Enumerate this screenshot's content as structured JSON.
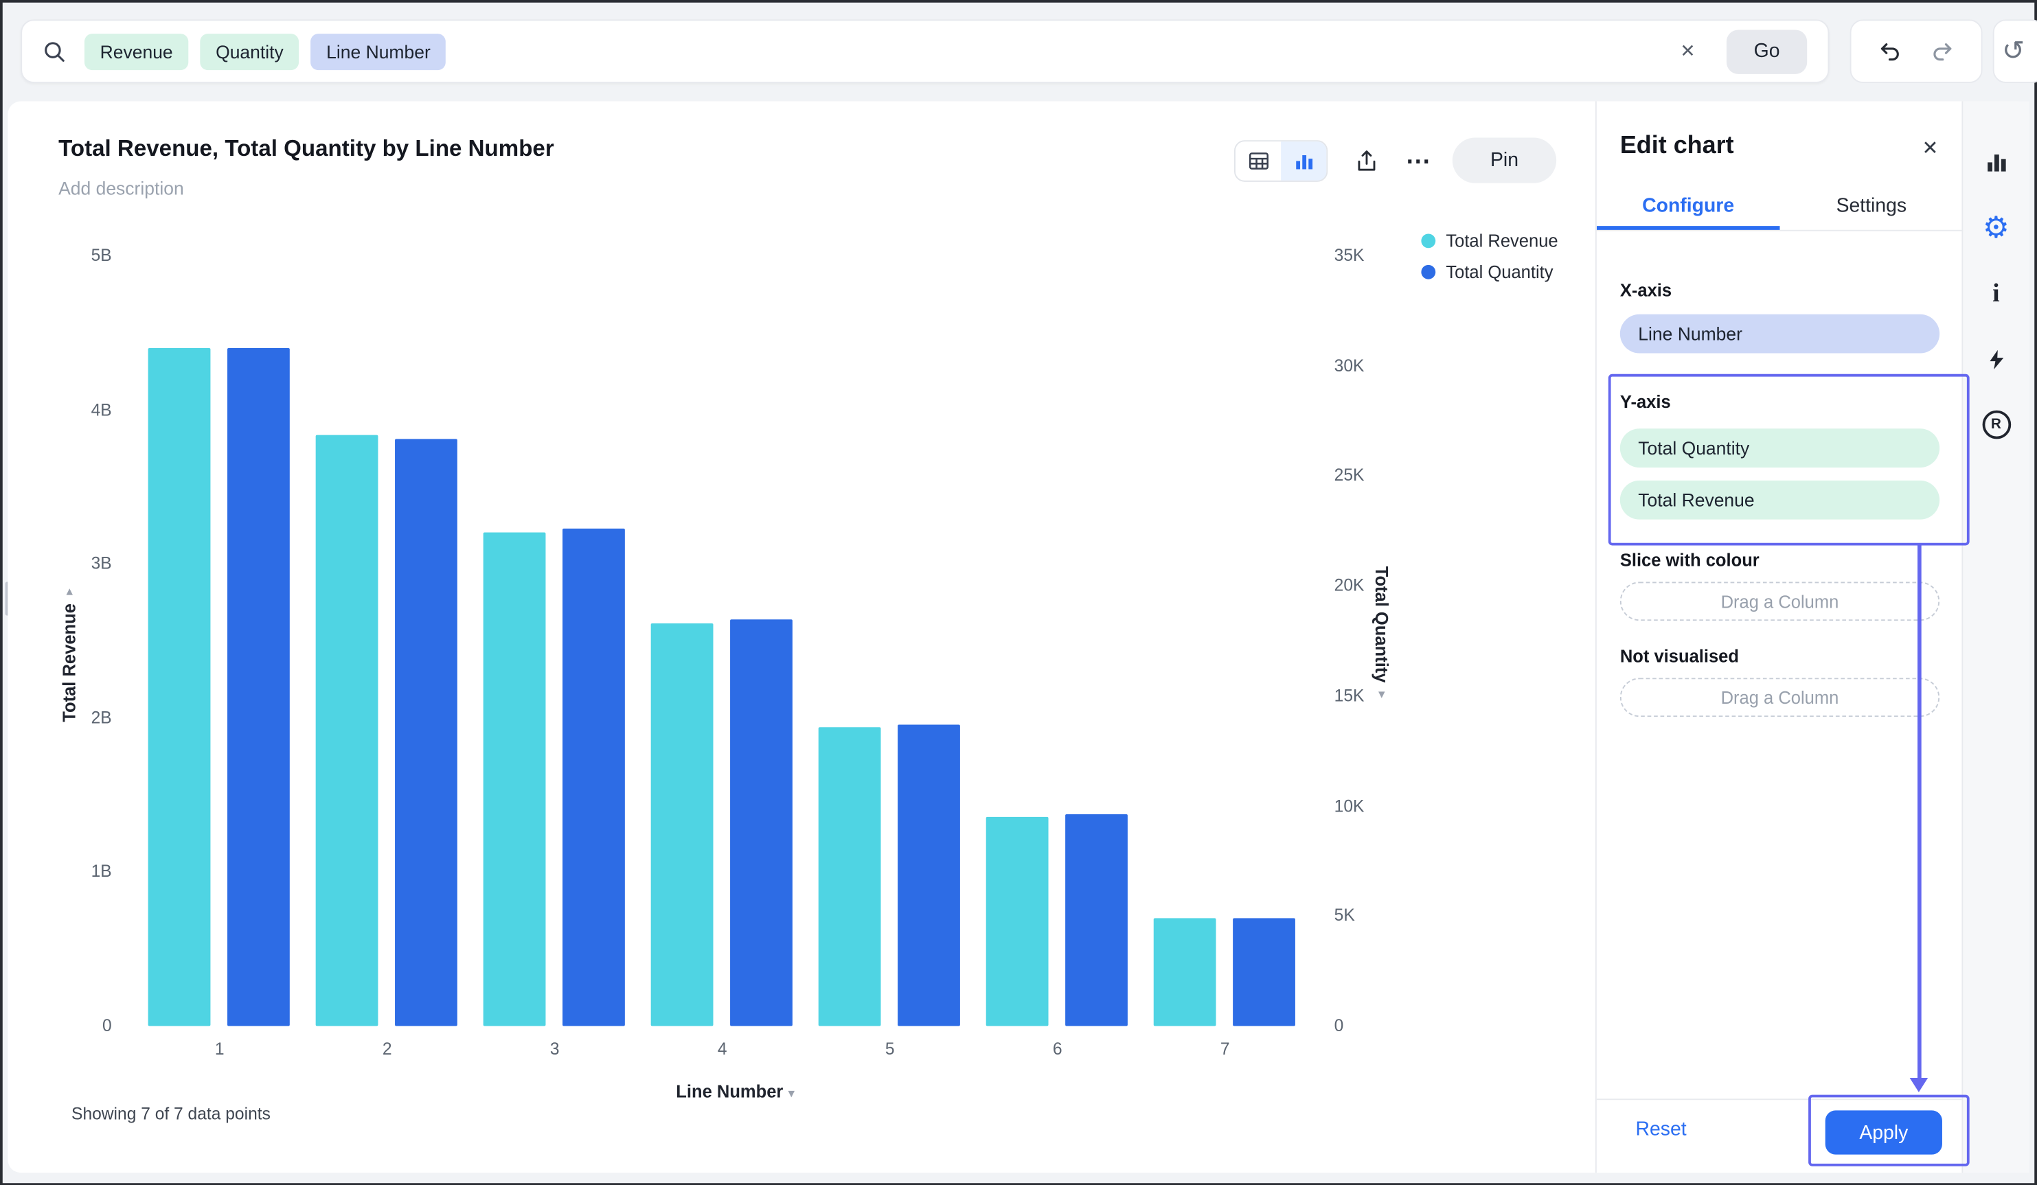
{
  "colors": {
    "accent_blue": "#2b6ef2",
    "annotation_purple": "#6467ef",
    "bar_cyan": "#4fd4e3",
    "bar_blue": "#2d6ce5",
    "token_green": "#d8f3e7",
    "token_lavender": "#cdd8f7"
  },
  "icons": {
    "clear": "✕",
    "close": "✕",
    "ellipsis": "⋯",
    "history": "↺",
    "gear": "⚙",
    "caret": "▾",
    "info": "i",
    "r_badge": "R"
  },
  "topbar": {
    "tokens": [
      "Revenue",
      "Quantity",
      "Line Number"
    ],
    "go_label": "Go"
  },
  "chart_header": {
    "title": "Total Revenue, Total Quantity by Line Number",
    "description_placeholder": "Add description",
    "pin_label": "Pin"
  },
  "chart_data": {
    "type": "bar",
    "title": "Total Revenue, Total Quantity by Line Number",
    "categories": [
      "1",
      "2",
      "3",
      "4",
      "5",
      "6",
      "7"
    ],
    "series": [
      {
        "name": "Total Revenue",
        "axis": "left",
        "color": "#4fd4e3",
        "unit": "B",
        "values": [
          4.4,
          3.84,
          3.2,
          2.61,
          1.94,
          1.36,
          0.7
        ]
      },
      {
        "name": "Total Quantity",
        "axis": "right",
        "color": "#2d6ce5",
        "unit": "K",
        "values": [
          30.8,
          26.7,
          22.6,
          18.5,
          13.7,
          9.6,
          4.9
        ]
      }
    ],
    "left_axis": {
      "label": "Total Revenue",
      "max": 5,
      "ticks": [
        "5B",
        "4B",
        "3B",
        "2B",
        "1B",
        "0"
      ]
    },
    "right_axis": {
      "label": "Total Quantity",
      "max": 35,
      "ticks": [
        "35K",
        "30K",
        "25K",
        "20K",
        "15K",
        "10K",
        "5K",
        "0"
      ]
    },
    "x_axis": {
      "label": "Line Number"
    },
    "legend_position": "top-right",
    "grid": false,
    "footer": "Showing 7 of 7 data points"
  },
  "edit_panel": {
    "title": "Edit chart",
    "tabs": [
      "Configure",
      "Settings"
    ],
    "active_tab": "Configure",
    "x_axis_label": "X-axis",
    "x_axis_value": "Line Number",
    "y_axis_label": "Y-axis",
    "y_axis_values": [
      "Total Quantity",
      "Total Revenue"
    ],
    "slice_label": "Slice with colour",
    "slice_placeholder": "Drag a Column",
    "not_visualised_label": "Not visualised",
    "not_visualised_placeholder": "Drag a Column",
    "reset_label": "Reset",
    "apply_label": "Apply"
  }
}
